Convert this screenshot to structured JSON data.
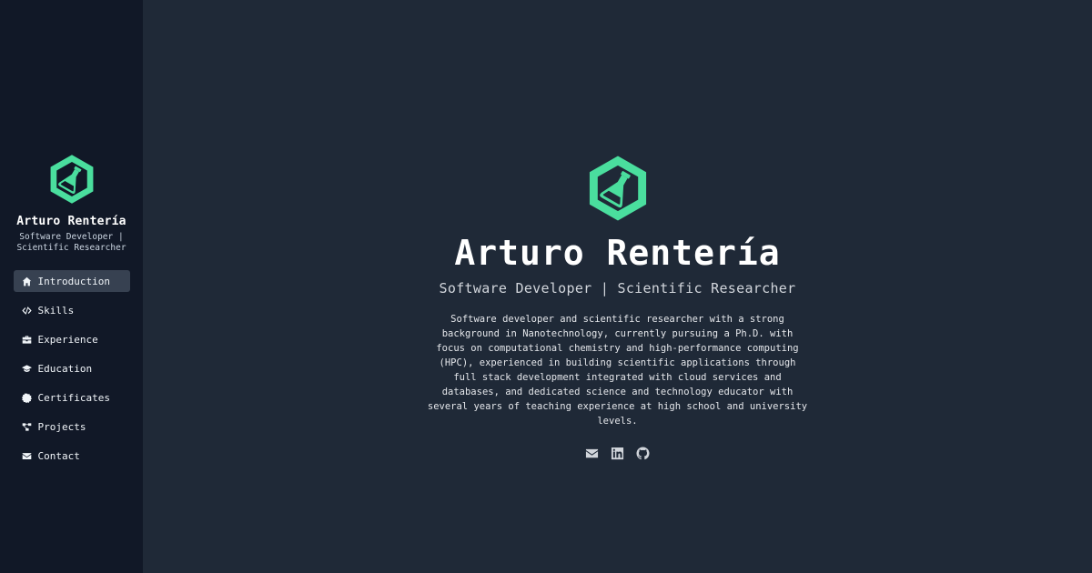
{
  "colors": {
    "accent": "#4ade9e",
    "sidebar_bg": "#111827",
    "main_bg": "#1f2937",
    "active_item_bg": "#374151"
  },
  "sidebar": {
    "logo_icon": "flask-hexagon-icon",
    "name": "Arturo Rentería",
    "subtitle": "Software Developer | Scientific Researcher",
    "nav": [
      {
        "label": "Introduction",
        "icon": "home-icon",
        "active": true
      },
      {
        "label": "Skills",
        "icon": "code-icon",
        "active": false
      },
      {
        "label": "Experience",
        "icon": "briefcase-icon",
        "active": false
      },
      {
        "label": "Education",
        "icon": "graduation-cap-icon",
        "active": false
      },
      {
        "label": "Certificates",
        "icon": "certificate-icon",
        "active": false
      },
      {
        "label": "Projects",
        "icon": "project-diagram-icon",
        "active": false
      },
      {
        "label": "Contact",
        "icon": "envelope-icon",
        "active": false
      }
    ]
  },
  "hero": {
    "logo_icon": "flask-hexagon-icon",
    "name": "Arturo Rentería",
    "subtitle": "Software Developer | Scientific Researcher",
    "bio": "Software developer and scientific researcher with a strong background in Nanotechnology, currently pursuing a Ph.D. with focus on computational chemistry and high-performance computing (HPC), experienced in building scientific applications through full stack development integrated with cloud services and databases, and dedicated science and technology educator with several years of teaching experience at high school and university levels.",
    "social": [
      "envelope-icon",
      "linkedin-icon",
      "github-icon"
    ]
  }
}
